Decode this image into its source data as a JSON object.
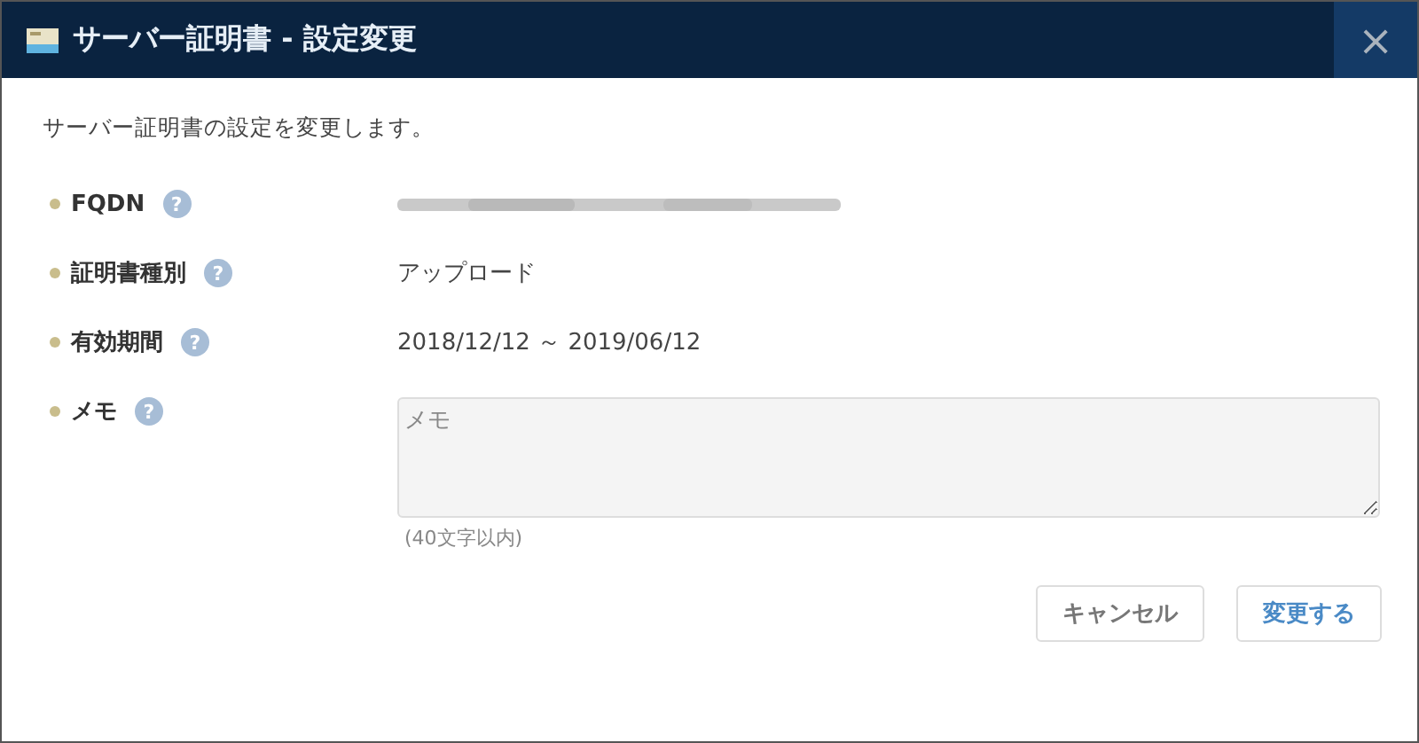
{
  "dialog": {
    "title": "サーバー証明書 - 設定変更",
    "close": "×"
  },
  "description": "サーバー証明書の設定を変更します。",
  "fields": [
    {
      "kind": "redacted",
      "label": "FQDN",
      "help": "?"
    },
    {
      "kind": "text",
      "label": "証明書種別",
      "help": "?",
      "value": "アップロード"
    },
    {
      "kind": "text",
      "label": "有効期間",
      "help": "?",
      "value": "2018/12/12 ～ 2019/06/12"
    },
    {
      "kind": "memo",
      "label": "メモ",
      "help": "?",
      "placeholder": "メモ",
      "hint": "(40文字以内)"
    }
  ],
  "buttons": [
    {
      "label": "キャンセル",
      "kind": "secondary"
    },
    {
      "label": "変更する",
      "kind": "primary"
    }
  ]
}
